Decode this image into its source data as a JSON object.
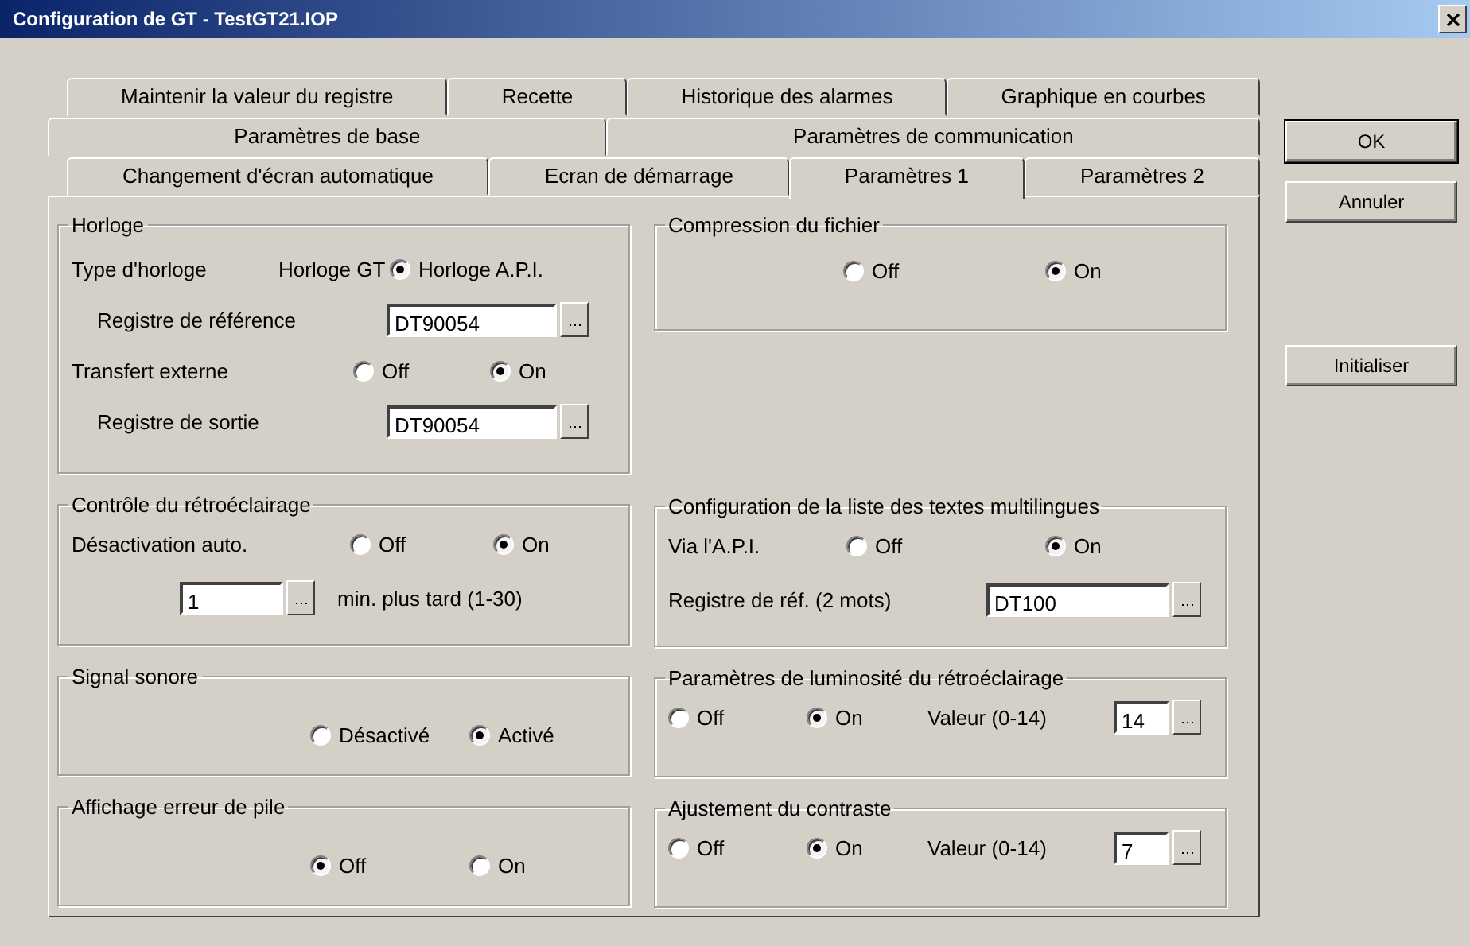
{
  "window": {
    "title": "Configuration de GT - TestGT21.IOP"
  },
  "tab_rows": [
    [
      {
        "label": "Maintenir la valeur du registre",
        "selected": false
      },
      {
        "label": "Recette",
        "selected": false
      },
      {
        "label": "Historique des alarmes",
        "selected": false
      },
      {
        "label": "Graphique en courbes",
        "selected": false
      }
    ],
    [
      {
        "label": "Paramètres de base",
        "selected": false
      },
      {
        "label": "Paramètres de communication",
        "selected": false
      }
    ],
    [
      {
        "label": "Changement d'écran automatique",
        "selected": false
      },
      {
        "label": "Ecran de démarrage",
        "selected": false
      },
      {
        "label": "Paramètres 1",
        "selected": true
      },
      {
        "label": "Paramètres 2",
        "selected": false
      }
    ]
  ],
  "left_column": [
    {
      "title": "Horloge",
      "rows": [
        {
          "items": [
            {
              "kind": "label",
              "text": "Type d'horloge"
            },
            {
              "kind": "label",
              "text": "Horloge GT"
            },
            {
              "kind": "radio",
              "text": "Horloge A.P.I.",
              "selected": true
            }
          ]
        },
        {
          "items": [
            {
              "kind": "label",
              "text": "Registre de référence"
            },
            {
              "kind": "field",
              "value": "DT90054"
            }
          ]
        },
        {
          "items": [
            {
              "kind": "label",
              "text": "Transfert externe"
            },
            {
              "kind": "radio",
              "text": "Off",
              "selected": false
            },
            {
              "kind": "radio",
              "text": "On",
              "selected": true
            }
          ]
        },
        {
          "items": [
            {
              "kind": "label",
              "text": "Registre de sortie"
            },
            {
              "kind": "field",
              "value": "DT90054"
            }
          ]
        }
      ]
    },
    {
      "title": "Contrôle du rétroéclairage",
      "rows": [
        {
          "items": [
            {
              "kind": "label",
              "text": "Désactivation auto."
            },
            {
              "kind": "radio",
              "text": "Off",
              "selected": false
            },
            {
              "kind": "radio",
              "text": "On",
              "selected": true
            }
          ]
        },
        {
          "items": [
            {
              "kind": "field",
              "value": "1"
            },
            {
              "kind": "label",
              "text": "min. plus tard (1-30)"
            }
          ]
        }
      ]
    },
    {
      "title": "Signal sonore",
      "rows": [
        {
          "items": [
            {
              "kind": "radio",
              "text": "Désactivé",
              "selected": false
            },
            {
              "kind": "radio",
              "text": "Activé",
              "selected": true
            }
          ]
        }
      ]
    },
    {
      "title": "Affichage erreur de pile",
      "rows": [
        {
          "items": [
            {
              "kind": "radio",
              "text": "Off",
              "selected": true
            },
            {
              "kind": "radio",
              "text": "On",
              "selected": false
            }
          ]
        }
      ]
    }
  ],
  "right_column": [
    {
      "title": "Compression du fichier",
      "rows": [
        {
          "items": [
            {
              "kind": "radio",
              "text": "Off",
              "selected": false
            },
            {
              "kind": "radio",
              "text": "On",
              "selected": true
            }
          ]
        }
      ]
    },
    {
      "title": "Configuration de la liste des textes multilingues",
      "rows": [
        {
          "items": [
            {
              "kind": "label",
              "text": "Via l'A.P.I."
            },
            {
              "kind": "radio",
              "text": "Off",
              "selected": false
            },
            {
              "kind": "radio",
              "text": "On",
              "selected": true
            }
          ]
        },
        {
          "items": [
            {
              "kind": "label",
              "text": "Registre de réf. (2 mots)"
            },
            {
              "kind": "field",
              "value": "DT100"
            }
          ]
        }
      ]
    },
    {
      "title": "Paramètres de luminosité du rétroéclairage",
      "rows": [
        {
          "items": [
            {
              "kind": "radio",
              "text": "Off",
              "selected": false
            },
            {
              "kind": "radio",
              "text": "On",
              "selected": true
            },
            {
              "kind": "label",
              "text": "Valeur (0-14)"
            },
            {
              "kind": "field",
              "value": "14"
            }
          ]
        }
      ]
    },
    {
      "title": "Ajustement du contraste",
      "rows": [
        {
          "items": [
            {
              "kind": "radio",
              "text": "Off",
              "selected": false
            },
            {
              "kind": "radio",
              "text": "On",
              "selected": true
            },
            {
              "kind": "label",
              "text": "Valeur (0-14)"
            },
            {
              "kind": "field",
              "value": "7"
            }
          ]
        }
      ]
    }
  ],
  "buttons": [
    {
      "label": "OK"
    },
    {
      "label": "Annuler"
    },
    {
      "label": "Initialiser"
    }
  ]
}
